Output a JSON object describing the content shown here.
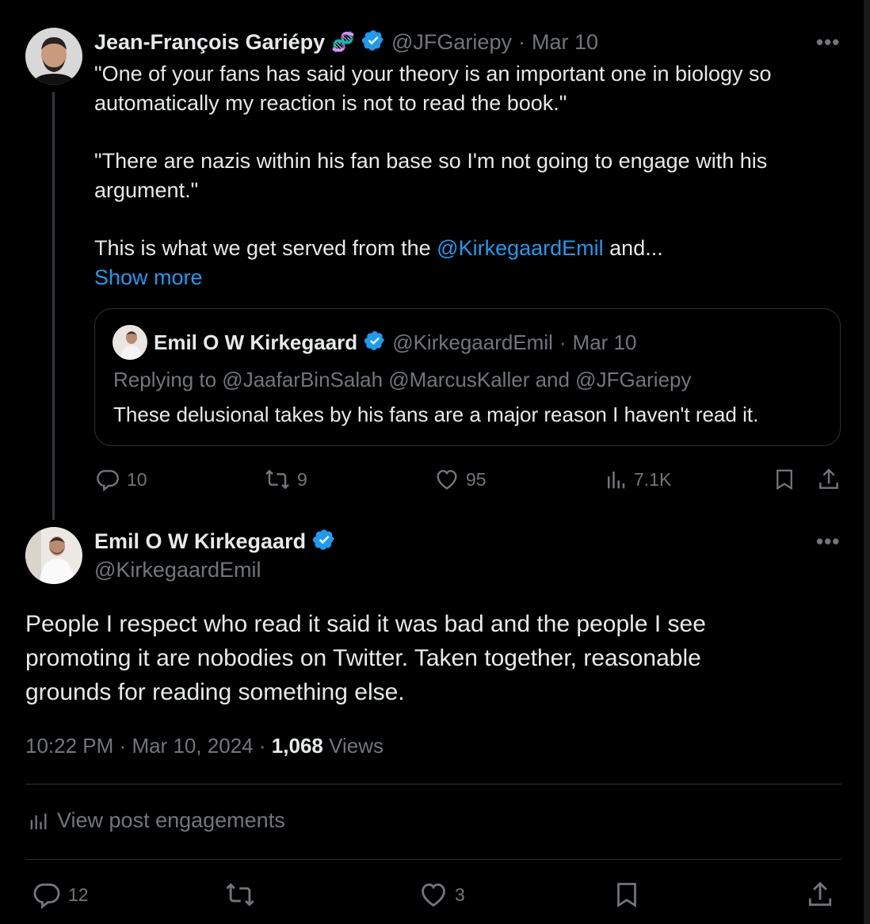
{
  "parent_tweet": {
    "author_name": "Jean-François Gariépy",
    "emoji": "🧬",
    "handle": "@JFGariepy",
    "sep": "·",
    "date": "Mar 10",
    "more": "•••",
    "line1": "\"One of your fans has said your theory is an important one in biology so",
    "line2": "automatically my reaction is not to read the book.\"",
    "line3": "\"There are nazis within his fan base so I'm not going to engage with his",
    "line4": "argument.\"",
    "line5_pre": "This is what we get served from the ",
    "line5_mention": "@KirkegaardEmil",
    "line5_post": " and...",
    "show_more": "Show more",
    "quote": {
      "author_name": "Emil O W Kirkegaard",
      "handle": "@KirkegaardEmil",
      "sep": "·",
      "date": "Mar 10",
      "replying_to": "Replying to @JaafarBinSalah @MarcusKaller and @JFGariepy",
      "text": "These delusional takes by his fans are a major reason I haven't read it."
    },
    "actions": {
      "replies": "10",
      "reposts": "9",
      "likes": "95",
      "views": "7.1K"
    }
  },
  "main_tweet": {
    "author_name": "Emil O W Kirkegaard",
    "handle": "@KirkegaardEmil",
    "more": "•••",
    "line1": "People I respect who read it said it was bad and the people I see",
    "line2": "promoting it are nobodies on Twitter. Taken together, reasonable",
    "line3": "grounds for reading something else.",
    "time": "10:22 PM",
    "sep": "·",
    "date": "Mar 10, 2024",
    "sep2": "·",
    "views_count": "1,068",
    "views_label": " Views",
    "engagements": "View post engagements",
    "actions": {
      "replies": "12",
      "likes": "3"
    }
  },
  "colors": {
    "background": "#000000",
    "text": "#e7e9ea",
    "muted": "#71767b",
    "link": "#1d9bf0",
    "border": "#2f3336"
  }
}
